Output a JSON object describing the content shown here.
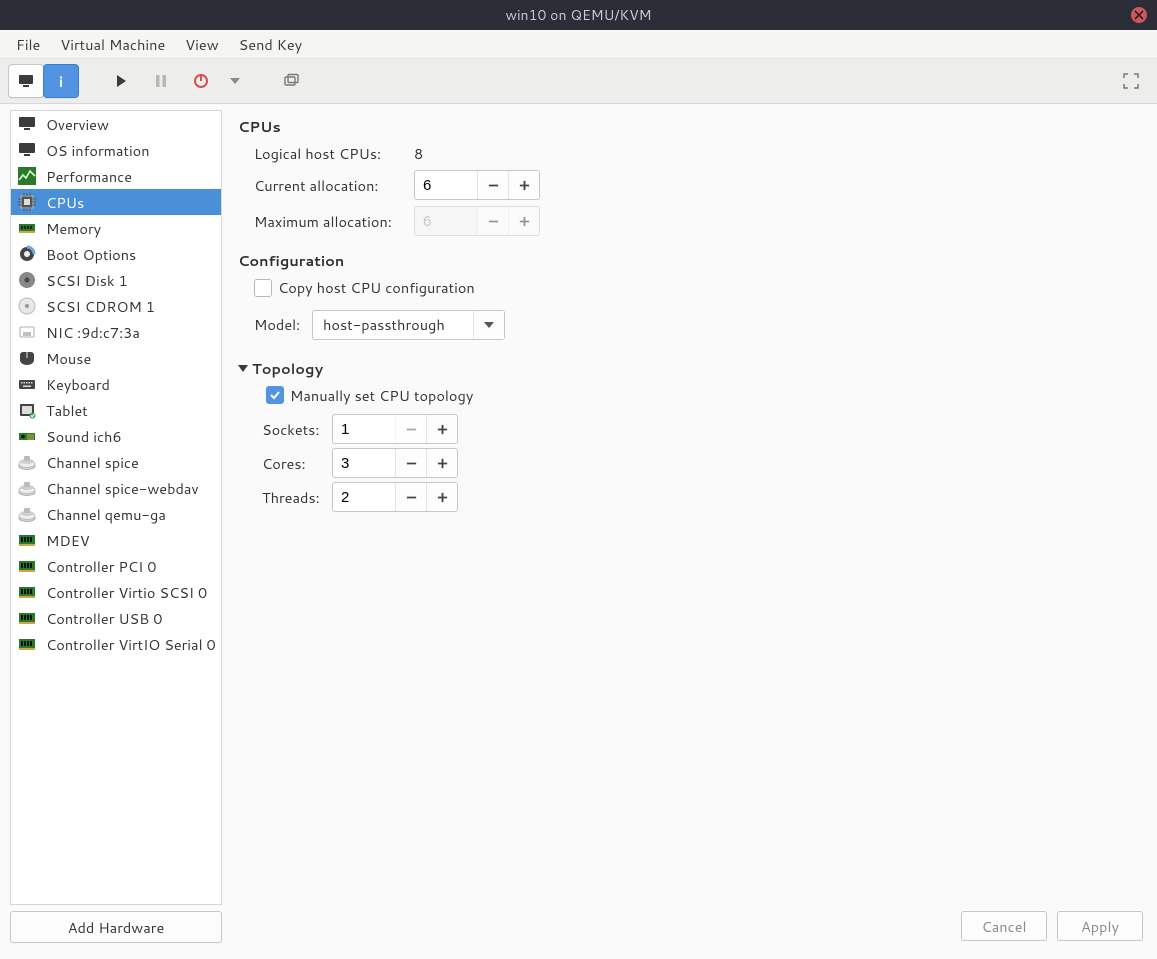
{
  "window": {
    "title": "win10 on QEMU/KVM"
  },
  "menubar": [
    "File",
    "Virtual Machine",
    "View",
    "Send Key"
  ],
  "sidebar": {
    "items": [
      {
        "id": "overview",
        "label": "Overview",
        "icon": "monitor-icon"
      },
      {
        "id": "osinfo",
        "label": "OS information",
        "icon": "monitor-icon"
      },
      {
        "id": "performance",
        "label": "Performance",
        "icon": "performance-icon"
      },
      {
        "id": "cpus",
        "label": "CPUs",
        "icon": "cpu-icon",
        "selected": true
      },
      {
        "id": "memory",
        "label": "Memory",
        "icon": "memory-icon"
      },
      {
        "id": "boot",
        "label": "Boot Options",
        "icon": "boot-icon"
      },
      {
        "id": "scsi-disk-1",
        "label": "SCSI Disk 1",
        "icon": "disk-icon"
      },
      {
        "id": "scsi-cdrom-1",
        "label": "SCSI CDROM 1",
        "icon": "cdrom-icon"
      },
      {
        "id": "nic",
        "label": "NIC :9d:c7:3a",
        "icon": "nic-icon"
      },
      {
        "id": "mouse",
        "label": "Mouse",
        "icon": "mouse-icon"
      },
      {
        "id": "keyboard",
        "label": "Keyboard",
        "icon": "keyboard-icon"
      },
      {
        "id": "tablet",
        "label": "Tablet",
        "icon": "tablet-icon"
      },
      {
        "id": "sound",
        "label": "Sound ich6",
        "icon": "sound-icon"
      },
      {
        "id": "ch-spice",
        "label": "Channel spice",
        "icon": "channel-icon"
      },
      {
        "id": "ch-webdav",
        "label": "Channel spice-webdav",
        "icon": "channel-icon"
      },
      {
        "id": "ch-qemu-ga",
        "label": "Channel qemu-ga",
        "icon": "channel-icon"
      },
      {
        "id": "mdev",
        "label": "MDEV",
        "icon": "pci-icon"
      },
      {
        "id": "ctrl-pci",
        "label": "Controller PCI 0",
        "icon": "pci-icon"
      },
      {
        "id": "ctrl-vscsi",
        "label": "Controller Virtio SCSI 0",
        "icon": "pci-icon"
      },
      {
        "id": "ctrl-usb",
        "label": "Controller USB 0",
        "icon": "pci-icon"
      },
      {
        "id": "ctrl-vserial",
        "label": "Controller VirtIO Serial 0",
        "icon": "pci-icon"
      }
    ],
    "add_hw_label": "Add Hardware"
  },
  "cpus": {
    "heading": "CPUs",
    "logical_label": "Logical host CPUs:",
    "logical_value": "8",
    "current_label": "Current allocation:",
    "current_value": "6",
    "max_label": "Maximum allocation:",
    "max_value": "6",
    "config_heading": "Configuration",
    "copy_host_label": "Copy host CPU configuration",
    "copy_host_checked": false,
    "model_label": "Model:",
    "model_value": "host-passthrough",
    "topology_heading": "Topology",
    "manual_topology_label": "Manually set CPU topology",
    "manual_topology_checked": true,
    "sockets_label": "Sockets:",
    "sockets_value": "1",
    "cores_label": "Cores:",
    "cores_value": "3",
    "threads_label": "Threads:",
    "threads_value": "2"
  },
  "footer": {
    "cancel": "Cancel",
    "apply": "Apply"
  }
}
